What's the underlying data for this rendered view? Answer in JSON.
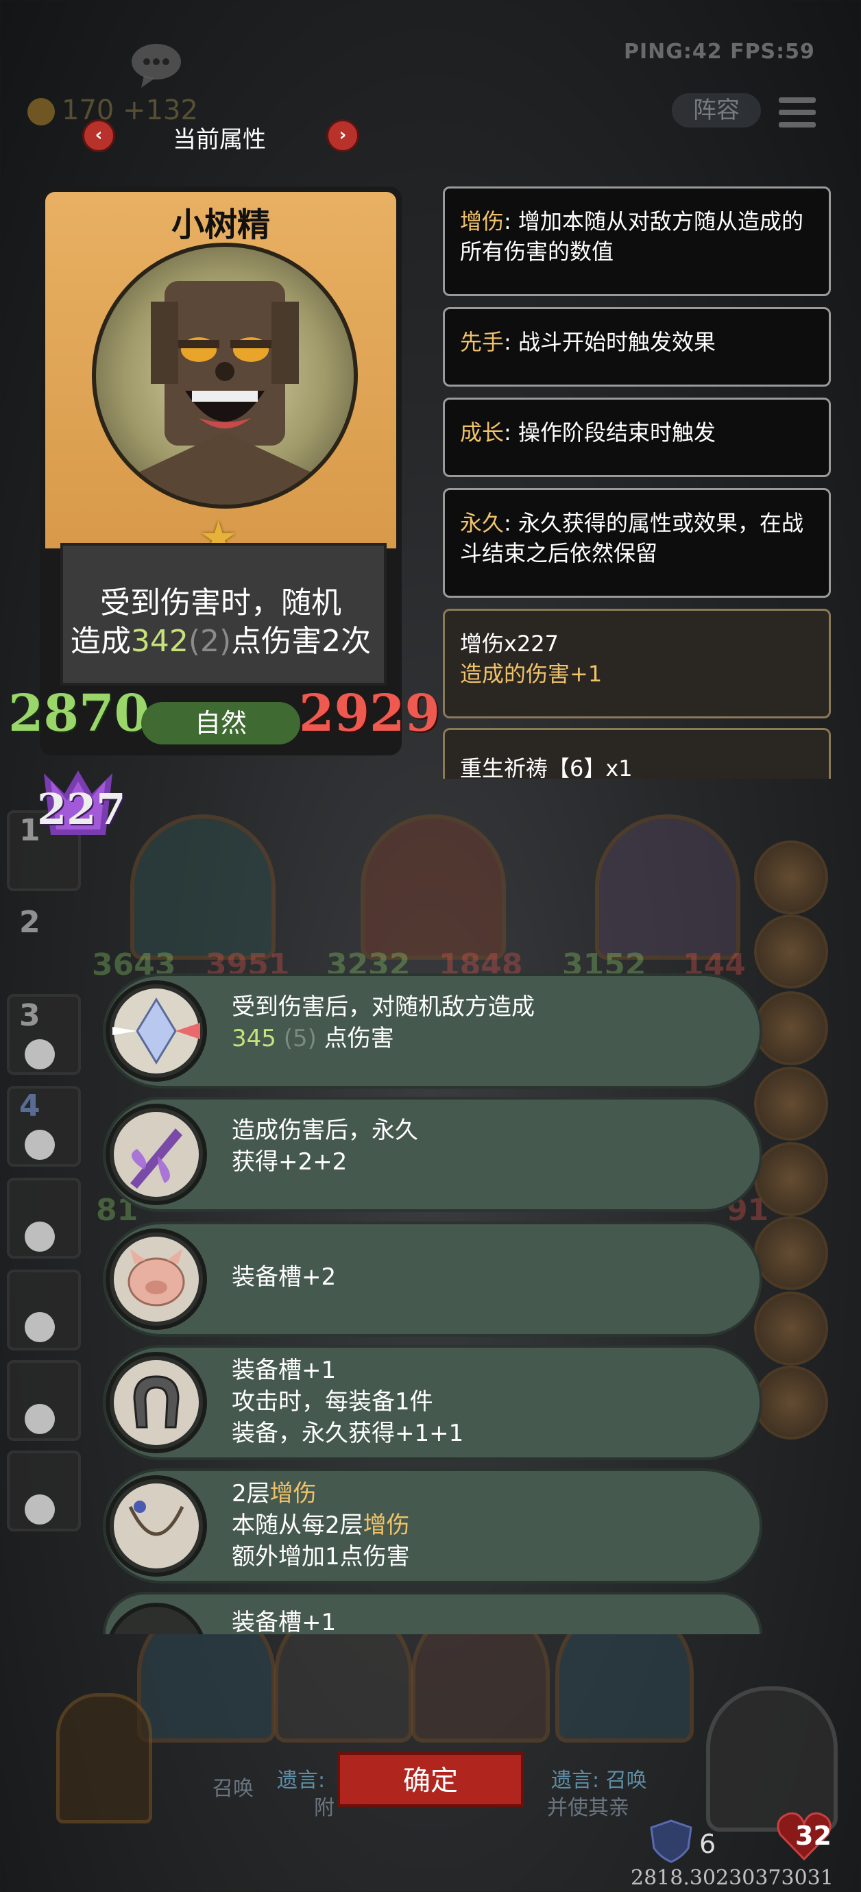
{
  "hud": {
    "ping_fps": "PING:42 FPS:59",
    "gold": "170 +132",
    "team_button": "阵容"
  },
  "attribute_header": {
    "title": "当前属性",
    "prev": "‹",
    "next": "›"
  },
  "unit_card": {
    "name": "小树精",
    "desc_line1": "受到伤害时，随机",
    "desc_line2_prefix": "造成",
    "desc_damage": "342",
    "desc_damage_extra": "(2)",
    "desc_line2_suffix": "点伤害2次",
    "attack": "2870",
    "health": "2929",
    "type": "自然",
    "buff_stacks": "227",
    "colors": {
      "frame_top": "#e8b063",
      "attack": "#9ad66a",
      "health": "#ef5a50",
      "type_badge": "#3f6a32"
    }
  },
  "keywords": [
    {
      "key": "增伤",
      "text": ": 增加本随从对敌方随从造成的所有伤害的数值"
    },
    {
      "key": "先手",
      "text": ": 战斗开始时触发效果"
    },
    {
      "key": "成长",
      "text": ": 操作阶段结束时触发"
    },
    {
      "key": "永久",
      "text": ": 永久获得的属性或效果，在战斗结束之后依然保留"
    }
  ],
  "stat_panels": [
    {
      "title": "增伤x227",
      "effect": "造成的伤害+1"
    },
    {
      "title": "重生祈祷【6】x1"
    }
  ],
  "background": {
    "board_numbers": [
      "3643",
      "3951",
      "3232",
      "1848",
      "3152",
      "144",
      "81",
      "91"
    ],
    "queue_numbers": [
      "1",
      "2",
      "3",
      "4"
    ],
    "shield": "6",
    "lives": "32",
    "bottom_labels": [
      "召唤",
      "遗言:",
      "遗言: 召唤",
      "附",
      "并使其亲"
    ]
  },
  "options": [
    {
      "line1": "受到伤害后，对随机敌方造成",
      "value": "345",
      "value_extra": "(5)",
      "line2_suffix": " 点伤害",
      "icon": "prism-crystal-icon"
    },
    {
      "line1": "造成伤害后，永久",
      "line2": "获得+2+2",
      "icon": "cursed-sword-icon"
    },
    {
      "line1": "装备槽+2",
      "icon": "pig-armor-icon"
    },
    {
      "line1": "装备槽+1",
      "line2": "攻击时，每装备1件",
      "line3": "装备，永久获得+1+1",
      "icon": "horseshoe-icon"
    },
    {
      "line1_prefix": "2层",
      "line1_key": "增伤",
      "line2_prefix": "本随从每2层",
      "line2_key": "增伤",
      "line3": "额外增加1点伤害",
      "icon": "necklace-icon"
    },
    {
      "line1": "装备槽+1",
      "icon": "unknown-item-icon"
    }
  ],
  "confirm_button": "确定",
  "version": "2818.30230373031"
}
